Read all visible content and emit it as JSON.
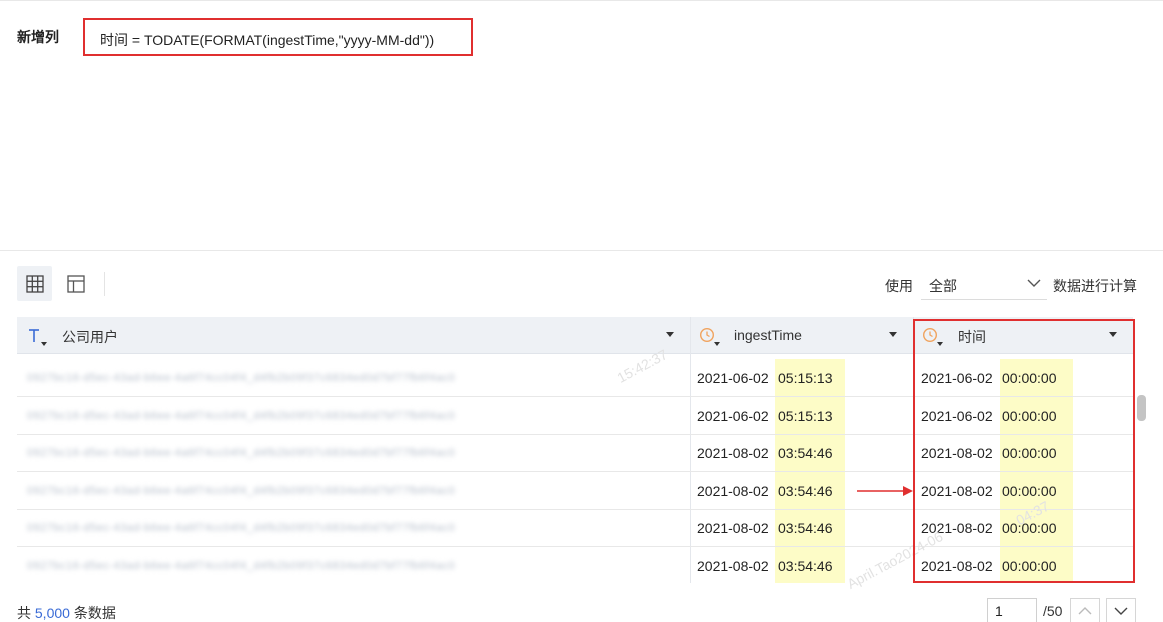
{
  "editor": {
    "label": "新增列",
    "formula": "时间 = TODATE(FORMAT(ingestTime,\"yyyy-MM-dd\"))"
  },
  "toolbar": {
    "use_label": "使用",
    "scope_value": "全部",
    "calc_label": "数据进行计算"
  },
  "table": {
    "columns": [
      {
        "label": "公司用户",
        "type_icon": "text-type-icon"
      },
      {
        "label": "ingestTime",
        "type_icon": "clock-type-icon"
      },
      {
        "label": "时间",
        "type_icon": "clock-type-icon"
      }
    ],
    "rows": [
      {
        "user": "0927bc16-d5ec-43ad-b6ee-4a6f74cc04f4_d4fb2b09f37c6834ed0d7bf77fb6f4ac0",
        "ingest_date": "2021-06-02",
        "ingest_time": "05:15:13",
        "date": "2021-06-02",
        "time": "00:00:00"
      },
      {
        "user": "0927bc16-d5ec-43ad-b6ee-4a6f74cc04f4_d4fb2b09f37c6834ed0d7bf77fb6f4ac0",
        "ingest_date": "2021-06-02",
        "ingest_time": "05:15:13",
        "date": "2021-06-02",
        "time": "00:00:00"
      },
      {
        "user": "0927bc16-d5ec-43ad-b6ee-4a6f74cc04f4_d4fb2b09f37c6834ed0d7bf77fb6f4ac0",
        "ingest_date": "2021-08-02",
        "ingest_time": "03:54:46",
        "date": "2021-08-02",
        "time": "00:00:00"
      },
      {
        "user": "0927bc16-d5ec-43ad-b6ee-4a6f74cc04f4_d4fb2b09f37c6834ed0d7bf77fb6f4ac0",
        "ingest_date": "2021-08-02",
        "ingest_time": "03:54:46",
        "date": "2021-08-02",
        "time": "00:00:00"
      },
      {
        "user": "0927bc16-d5ec-43ad-b6ee-4a6f74cc04f4_d4fb2b09f37c6834ed0d7bf77fb6f4ac0",
        "ingest_date": "2021-08-02",
        "ingest_time": "03:54:46",
        "date": "2021-08-02",
        "time": "00:00:00"
      },
      {
        "user": "0927bc16-d5ec-43ad-b6ee-4a6f74cc04f4_d4fb2b09f37c6834ed0d7bf77fb6f4ac0",
        "ingest_date": "2021-08-02",
        "ingest_time": "03:54:46",
        "date": "2021-08-02",
        "time": "00:00:00"
      }
    ]
  },
  "footer": {
    "total_prefix": "共",
    "total_count": "5,000",
    "total_suffix": "条数据",
    "current_page": "1",
    "page_total": "/50"
  },
  "watermarks": [
    "15:42:37",
    "April.Tao2024-06",
    "04:37"
  ],
  "colors": {
    "accent_red": "#e02f2f",
    "highlight_yellow": "#fdfccc",
    "link_blue": "#3a6bd6",
    "clock_orange": "#f0a35e",
    "header_bg": "#eef1f5"
  }
}
